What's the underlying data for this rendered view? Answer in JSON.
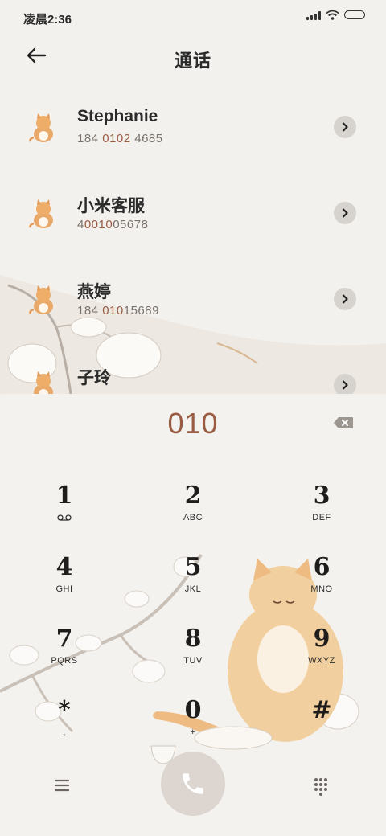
{
  "status_bar": {
    "time": "凌晨2:36"
  },
  "header": {
    "title": "通话"
  },
  "contacts": [
    {
      "name": "Stephanie",
      "num_pre": "184 ",
      "num_hl": "0102",
      "num_post": " 4685"
    },
    {
      "name": "小米客服",
      "num_pre": "4",
      "num_hl": "0010",
      "num_post": "05678"
    },
    {
      "name": "燕婷",
      "num_pre": "184 ",
      "num_hl": "010",
      "num_post": "15689"
    },
    {
      "name": "子玲",
      "num_pre": "",
      "num_hl": "",
      "num_post": ""
    }
  ],
  "dialer": {
    "input": "010",
    "keys": [
      {
        "digit": "1",
        "letters": ""
      },
      {
        "digit": "2",
        "letters": "ABC"
      },
      {
        "digit": "3",
        "letters": "DEF"
      },
      {
        "digit": "4",
        "letters": "GHI"
      },
      {
        "digit": "5",
        "letters": "JKL"
      },
      {
        "digit": "6",
        "letters": "MNO"
      },
      {
        "digit": "7",
        "letters": "PQRS"
      },
      {
        "digit": "8",
        "letters": "TUV"
      },
      {
        "digit": "9",
        "letters": "WXYZ"
      },
      {
        "digit": "*",
        "letters": ","
      },
      {
        "digit": "0",
        "letters": "+"
      },
      {
        "digit": "#",
        "letters": ""
      }
    ]
  },
  "colors": {
    "accent": "#9a5b43",
    "call_button": "#ddd5cf",
    "background": "#f3f1ee"
  },
  "icons": [
    "back-arrow-icon",
    "signal-icon",
    "wifi-icon",
    "battery-icon",
    "cat-avatar-icon",
    "chevron-right-icon",
    "backspace-icon",
    "voicemail-icon",
    "menu-icon",
    "phone-icon",
    "dialpad-icon"
  ]
}
